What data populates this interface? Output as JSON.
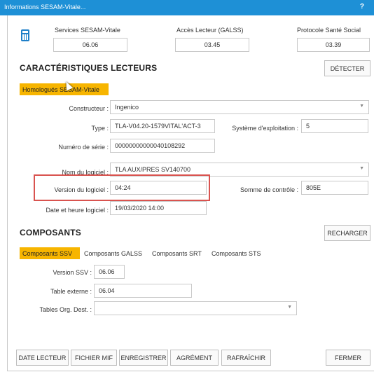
{
  "window": {
    "title": "Informations SESAM-Vitale...",
    "help": "?"
  },
  "versions": {
    "services_label": "Services SESAM-Vitale",
    "services_value": "06.06",
    "lecteur_label": "Accès Lecteur (GALSS)",
    "lecteur_value": "03.45",
    "protocole_label": "Protocole Santé Social",
    "protocole_value": "03.39"
  },
  "lecteurs": {
    "heading": "CARACTÉRISTIQUES LECTEURS",
    "detect_button": "DÉTECTER",
    "tab_label": "Homologués SESAM-Vitale",
    "constructeur_label": "Constructeur :",
    "constructeur_value": "Ingenico",
    "type_label": "Type :",
    "type_value": "TLA-V04.20-1579VITAL'ACT-3",
    "systeme_label": "Système d'exploitation :",
    "systeme_value": "5",
    "serie_label": "Numéro de série :",
    "serie_value": "00000000000040108292",
    "logiciel_label": "Nom du logiciel :",
    "logiciel_value": "TLA AUX/PRES  SV140700",
    "version_label": "Version du logiciel :",
    "version_value": "04:24",
    "somme_label": "Somme de contrôle :",
    "somme_value": "805E",
    "date_label": "Date et heure logiciel :",
    "date_value": "19/03/2020 14:00"
  },
  "composants": {
    "heading": "COMPOSANTS",
    "reload_button": "RECHARGER",
    "tabs": [
      "Composants SSV",
      "Composants GALSS",
      "Composants SRT",
      "Composants STS"
    ],
    "version_ssv_label": "Version SSV :",
    "version_ssv_value": "06.06",
    "table_externe_label": "Table externe :",
    "table_externe_value": "06.04",
    "tables_org_label": "Tables Org. Dest. :",
    "tables_org_value": ""
  },
  "footer": {
    "buttons": [
      "DATE LECTEUR",
      "FICHIER MIF",
      "ENREGISTRER",
      "AGRÉMENT",
      "RAFRAÎCHIR"
    ],
    "close": "FERMER"
  },
  "colors": {
    "titlebar": "#1e90d6",
    "accent_tab": "#f7b500",
    "highlight": "#d9534f"
  },
  "icons": {
    "app": "calculator-icon",
    "dropdown": "chevron-down-icon",
    "cursor": "mouse-cursor-icon"
  }
}
